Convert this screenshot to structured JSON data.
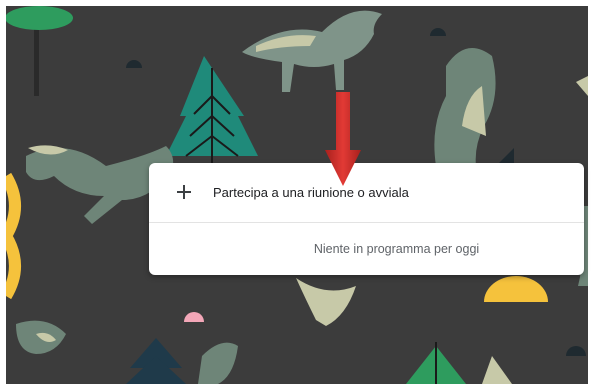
{
  "meeting_panel": {
    "join_label": "Partecipa a una riunione o avviala",
    "empty_message": "Niente in programma per oggi",
    "icon": "plus-icon"
  },
  "annotation": {
    "icon": "down-arrow-icon",
    "color": "#d9302c"
  },
  "background": {
    "color": "#3c3c3c",
    "theme": "wolves-forest-illustration"
  }
}
